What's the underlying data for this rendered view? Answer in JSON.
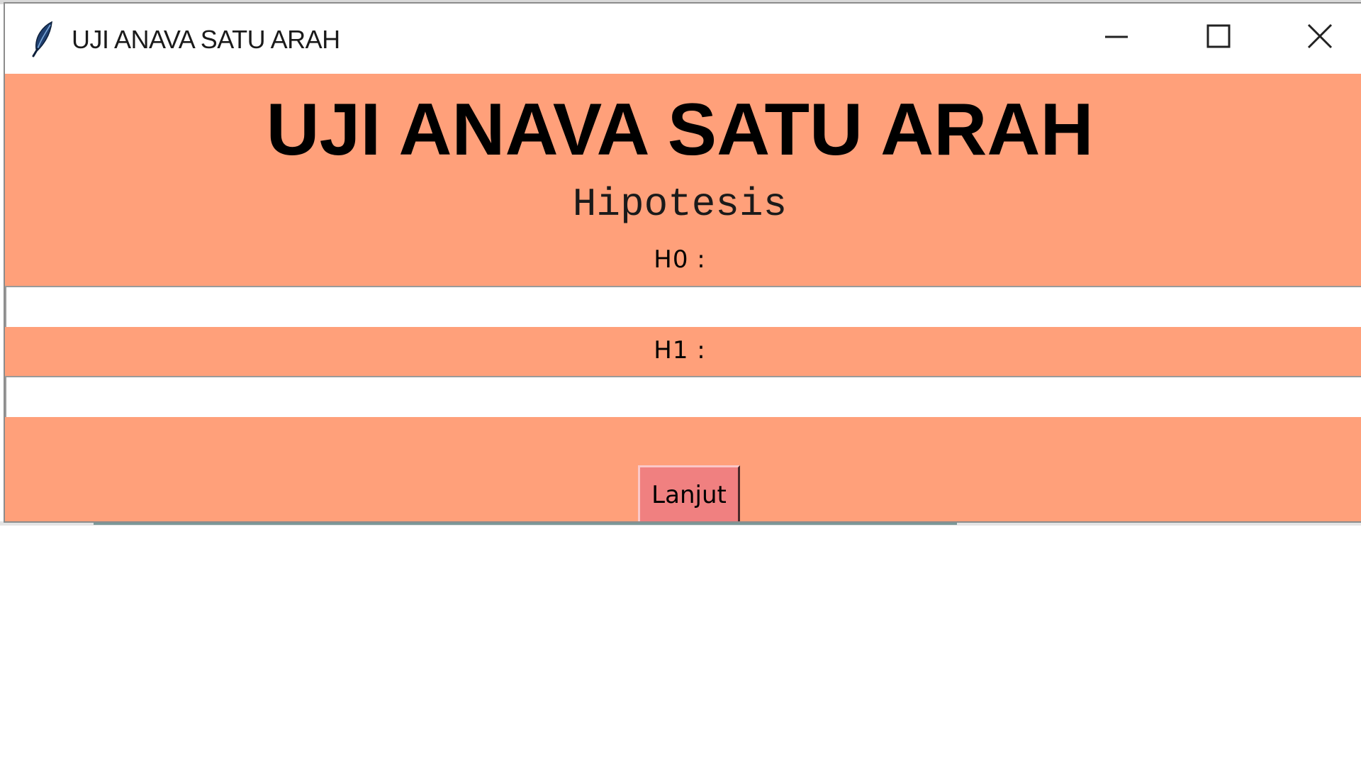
{
  "window": {
    "title": "UJI ANAVA SATU ARAH",
    "app_icon": "feather-icon",
    "controls": {
      "minimize_icon": "minimize-icon",
      "maximize_icon": "maximize-icon",
      "close_icon": "close-icon"
    }
  },
  "form": {
    "heading": "UJI ANAVA SATU ARAH",
    "subheading": "Hipotesis",
    "h0_label": "H0 :",
    "h0_value": "",
    "h1_label": "H1 :",
    "h1_value": "",
    "submit_label": "Lanjut"
  },
  "colors": {
    "background": "#ffa07a",
    "button": "#f08080",
    "input": "#ffffff"
  }
}
